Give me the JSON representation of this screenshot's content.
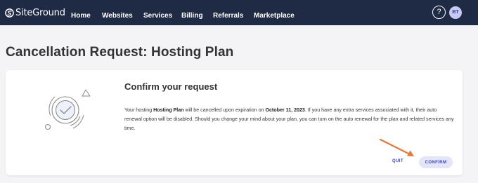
{
  "topnav": {
    "logo_text": "SiteGround",
    "items": [
      {
        "label": "Home"
      },
      {
        "label": "Websites"
      },
      {
        "label": "Services"
      },
      {
        "label": "Billing"
      },
      {
        "label": "Referrals"
      },
      {
        "label": "Marketplace"
      }
    ],
    "help_label": "?",
    "avatar_initials": "BT"
  },
  "page": {
    "title": "Cancellation Request: Hosting Plan"
  },
  "card": {
    "heading": "Confirm your request",
    "text_1": "Your hosting ",
    "plan_name": "Hosting Plan",
    "text_2": " will be cancelled upon expiration on ",
    "date": "October 11, 2023",
    "text_3": ". If you have any extra services associated with it, their auto renewal option will be disabled. Should you change your mind about your plan, you can turn on the auto renewal for the plan and related services any time."
  },
  "actions": {
    "quit_label": "QUIT",
    "confirm_label": "CONFIRM"
  },
  "colors": {
    "nav_bg": "#1f2a44",
    "accent": "#3c47b7",
    "confirm_bg": "#e5e5f9",
    "annotation_arrow": "#e07a3a"
  }
}
